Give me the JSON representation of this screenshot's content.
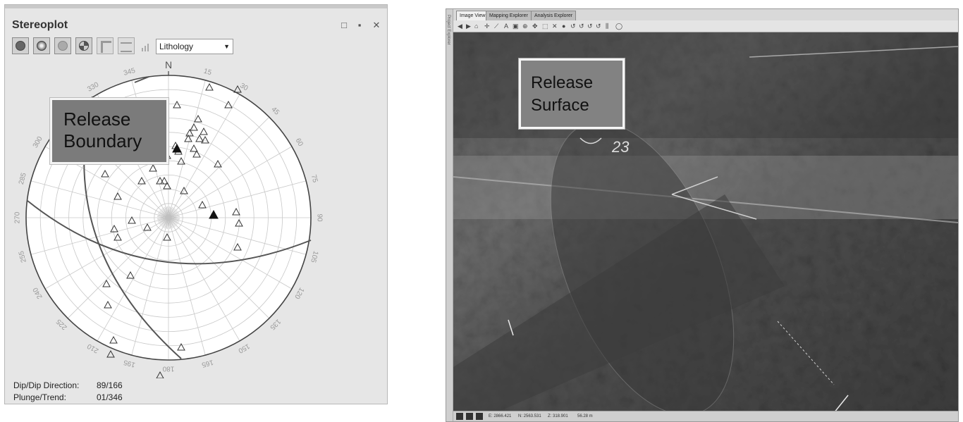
{
  "stereoplot": {
    "title": "Stereoplot",
    "window_controls": [
      "□",
      "▪",
      "✕"
    ],
    "lithology_selected": "Lithology",
    "north_label": "N",
    "azimuth_labels": [
      "15",
      "30",
      "45",
      "60",
      "75",
      "90",
      "105",
      "120",
      "135",
      "150",
      "165",
      "180",
      "195",
      "210",
      "225",
      "240",
      "255",
      "270",
      "285",
      "300",
      "315",
      "330",
      "345"
    ],
    "callout": [
      "Release",
      "Boundary"
    ],
    "readout": {
      "dip_label": "Dip/Dip Direction:",
      "dip_value": "89/166",
      "plunge_label": "Plunge/Trend:",
      "plunge_value": "01/346"
    },
    "colors": {
      "panel_bg": "#e6e6e6",
      "callout_bg": "#7b7b7b",
      "net_line": "#c8c8c8",
      "great_circle": "#555555"
    }
  },
  "image_view": {
    "side_label": "Project Explorer",
    "tabs": [
      "Image View",
      "Mapping Explorer",
      "Analysis Explorer"
    ],
    "active_tab": "Image View",
    "callout": [
      "Release",
      "Surface"
    ],
    "status": {
      "e": "E: 2866.421",
      "n": "N: 2563.531",
      "z": "Z: 318.901",
      "extra": "56.28 m"
    },
    "photo_label": "23"
  }
}
